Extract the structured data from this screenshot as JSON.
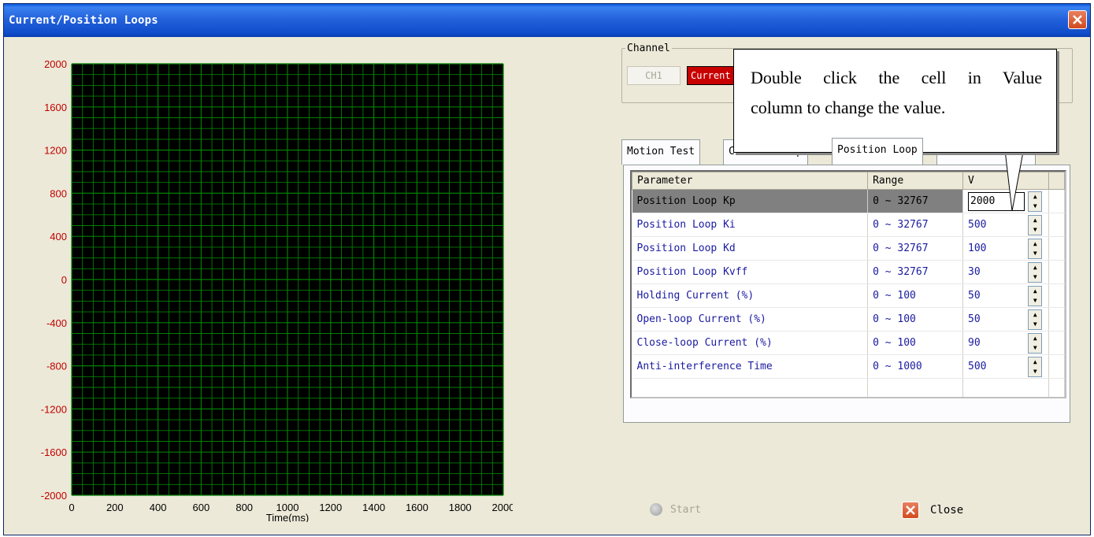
{
  "window": {
    "title": "Current/Position Loops",
    "close_icon": "close-icon"
  },
  "chart": {
    "y_ticks": [
      "2000",
      "1600",
      "1200",
      "800",
      "400",
      "0",
      "-400",
      "-800",
      "-1200",
      "-1600",
      "-2000"
    ],
    "x_ticks": [
      "0",
      "200",
      "400",
      "600",
      "800",
      "1000",
      "1200",
      "1400",
      "1600",
      "1800",
      "2000"
    ],
    "xlabel": "Time(ms)",
    "background": "#000000",
    "grid_color": "#008000"
  },
  "channel": {
    "legend": "Channel",
    "ch_button": "CH1",
    "ch_value": "Current"
  },
  "tabs": [
    {
      "label": "Motion Test"
    },
    {
      "label": "Current Loop"
    },
    {
      "label": "Position Loop"
    }
  ],
  "table": {
    "headers": {
      "parameter": "Parameter",
      "range": "Range",
      "value": "V"
    },
    "rows": [
      {
        "parameter": "Position Loop Kp",
        "range": "0 ~ 32767",
        "value": "2000"
      },
      {
        "parameter": "Position Loop Ki",
        "range": "0 ~ 32767",
        "value": "500"
      },
      {
        "parameter": "Position Loop Kd",
        "range": "0 ~ 32767",
        "value": "100"
      },
      {
        "parameter": "Position Loop Kvff",
        "range": "0 ~ 32767",
        "value": "30"
      },
      {
        "parameter": "Holding Current (%)",
        "range": "0 ~ 100",
        "value": "50"
      },
      {
        "parameter": "Open-loop Current (%)",
        "range": "0 ~ 100",
        "value": "50"
      },
      {
        "parameter": "Close-loop Current (%)",
        "range": "0 ~ 100",
        "value": "90"
      },
      {
        "parameter": "Anti-interference Time",
        "range": "0 ~ 1000",
        "value": "500"
      }
    ]
  },
  "buttons": {
    "start": "Start",
    "close": "Close"
  },
  "callout": {
    "line1": "Double click the cell in Value",
    "line2": "column to change the value."
  },
  "colors": {
    "titlebar": "#0a58d8",
    "window_bg": "#ece9d8",
    "selected_row": "#808080",
    "channel_value_bg": "#c80000"
  }
}
